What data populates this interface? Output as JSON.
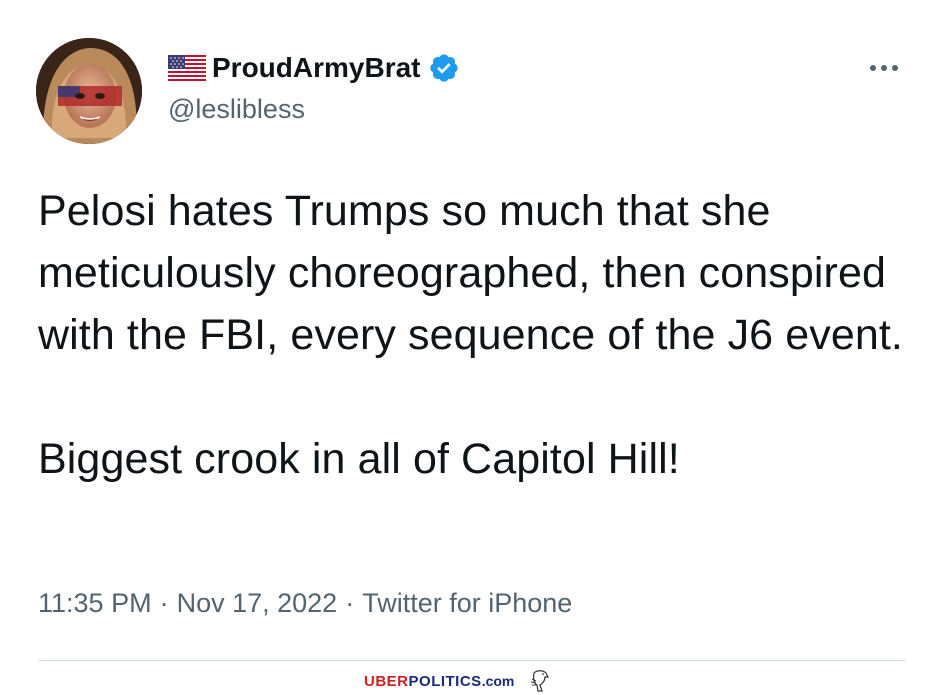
{
  "user": {
    "display_name": "ProudArmyBrat",
    "handle": "@leslibless",
    "flag_icon": "us-flag-icon",
    "verified_icon": "verified-badge-icon",
    "verified_color": "#1d9bf0"
  },
  "tweet": {
    "paragraphs": [
      "Pelosi hates Trumps so much that she meticulously choreographed, then conspired with the FBI, every sequence of the J6 event.",
      "Biggest crook in all of Capitol Hill!"
    ],
    "time": "11:35 PM",
    "separator": "·",
    "date": "Nov 17, 2022",
    "source": "Twitter for iPhone"
  },
  "actions": {
    "more_icon": "more-options-icon"
  },
  "watermark": {
    "part1": "UBER",
    "part2": "POLITICS",
    "part3": ".com",
    "color_red": "#d11f1f",
    "color_blue": "#1a2a7a",
    "icon": "eagle-icon"
  },
  "colors": {
    "text_primary": "#0f1419",
    "text_secondary": "#536471",
    "divider": "#cfd9de"
  }
}
